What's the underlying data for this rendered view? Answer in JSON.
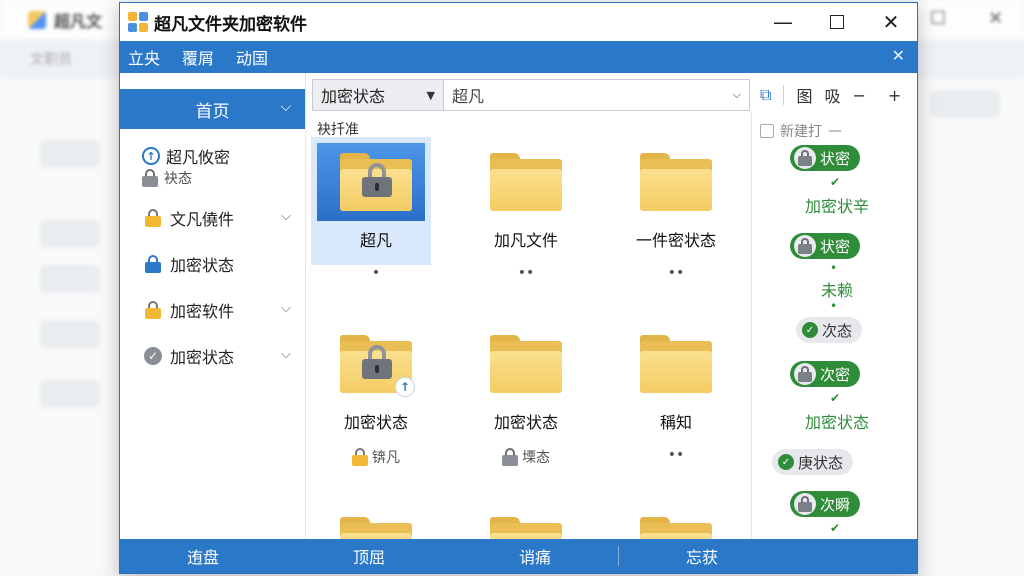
{
  "background_window": {
    "title": "超凡文",
    "menu_label": "文职员"
  },
  "window": {
    "title": "超凡文件夹加密软件",
    "minimize": "—",
    "close": "✕"
  },
  "menu": {
    "items": [
      "立央",
      "覆屑",
      "动国"
    ],
    "close": "✕"
  },
  "sidebar": {
    "home": "首页",
    "items": [
      {
        "label": "超凡攸密",
        "sub": "袂态"
      },
      {
        "label": "文凡僥件"
      },
      {
        "label": "加密状态"
      },
      {
        "label": "加密软件"
      },
      {
        "label": "加密状态"
      }
    ]
  },
  "toolbar": {
    "state_value": "加密状态",
    "path_value": "超凡",
    "icons": [
      "图",
      "吸",
      "−",
      "+"
    ]
  },
  "files": {
    "section_label": "袂扦准",
    "tiles": [
      {
        "name": "超凡",
        "meta": "•"
      },
      {
        "name": "加凡文件",
        "meta": "••"
      },
      {
        "name": "一件密状态",
        "meta": "••"
      },
      {
        "name": "加密状态",
        "meta": ""
      },
      {
        "name": "加密状态",
        "meta": ""
      },
      {
        "name": "稱知",
        "meta": "••"
      },
      {
        "name": "",
        "meta": "锛凡"
      },
      {
        "name": "",
        "meta": "塛态"
      }
    ],
    "row3_meta": [
      "锛凡",
      "塛态",
      "••"
    ]
  },
  "right_panel": {
    "header": "新建打",
    "pills": [
      "状密",
      "状密",
      "次态",
      "次密",
      "庚状态",
      "次瞬"
    ],
    "texts": [
      "加密状辛",
      "未赖",
      "加密状态"
    ]
  },
  "bottom": {
    "items": [
      "迶盘",
      "顶屈",
      "诮痛",
      "忘获"
    ]
  }
}
